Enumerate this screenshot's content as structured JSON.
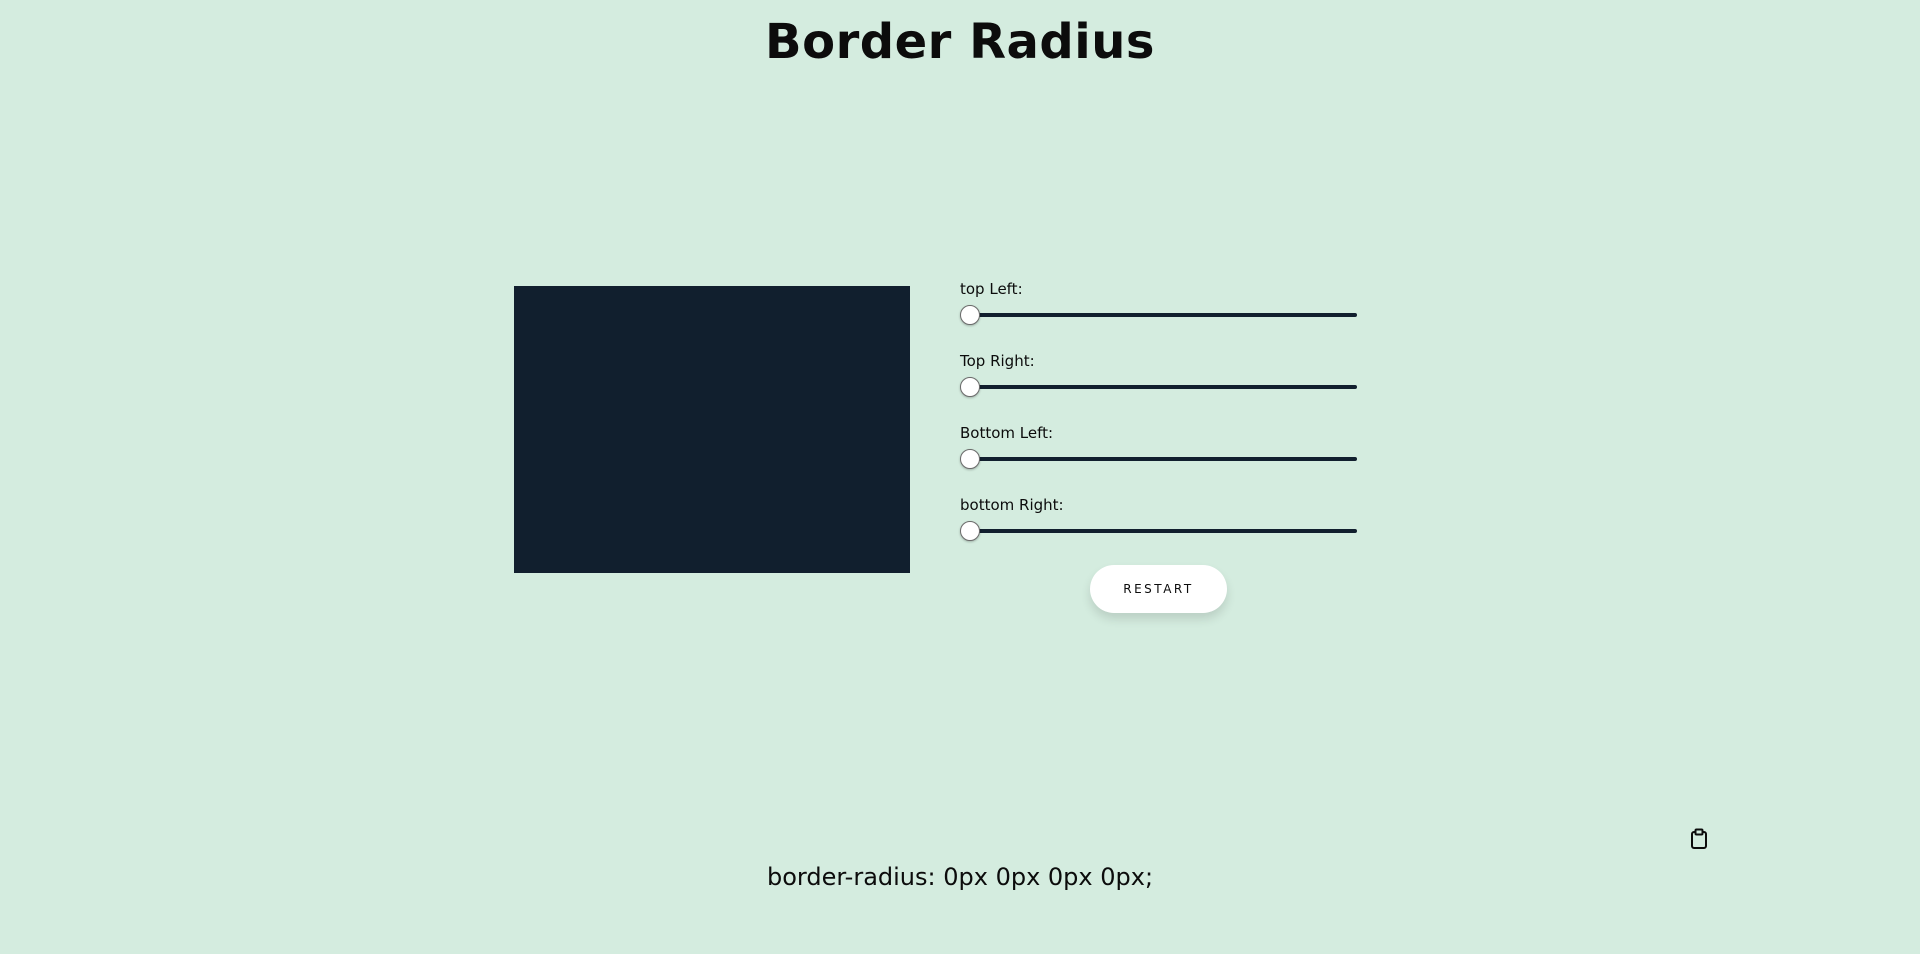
{
  "page": {
    "title": "Border Radius",
    "background": "#d4ecdf",
    "accent": "#111f2e"
  },
  "preview": {
    "color": "#111f2e"
  },
  "controls": [
    {
      "label": "top Left:",
      "value": 0,
      "min": 0,
      "max": 100
    },
    {
      "label": "Top Right:",
      "value": 0,
      "min": 0,
      "max": 100
    },
    {
      "label": "Bottom Left:",
      "value": 0,
      "min": 0,
      "max": 100
    },
    {
      "label": "bottom Right:",
      "value": 0,
      "min": 0,
      "max": 100
    }
  ],
  "restart_label": "RESTART",
  "copy_icon": "clipboard-icon",
  "output": "border-radius: 0px 0px 0px 0px;"
}
